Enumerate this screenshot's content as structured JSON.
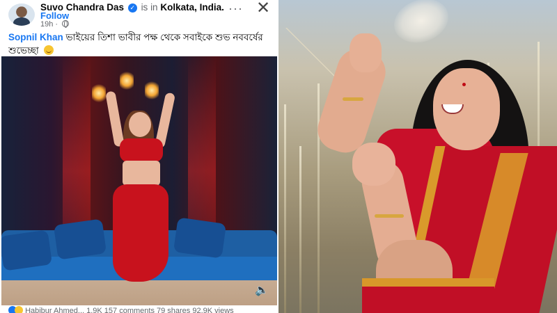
{
  "post": {
    "author": "Suvo Chandra Das",
    "verified_mark": "✓",
    "is_in": "is in",
    "location": "Kolkata, India.",
    "follow_label": "Follow",
    "time": "19h",
    "dot": "·",
    "more_label": "···",
    "close_label": "✕",
    "caption_mention": "Sopnil Khan",
    "caption_text": "ভাইয়ের তিশা ভাবীর পক্ষ থেকে সবাইকে শুভ নববর্ষের শুভেচ্ছা",
    "caption_emoji_name": "smile-emoji",
    "reaction_summary": "Habibur Ahmed... 1.9K    157 comments    79 shares    92.9K views",
    "mute_icon": "🔈"
  },
  "colors": {
    "facebook_blue": "#1877f2",
    "text_primary": "#050505",
    "text_secondary": "#65676b",
    "saree_red": "#c10f26",
    "saree_gold": "#d8982a",
    "sofa_blue": "#1f6fbf"
  }
}
